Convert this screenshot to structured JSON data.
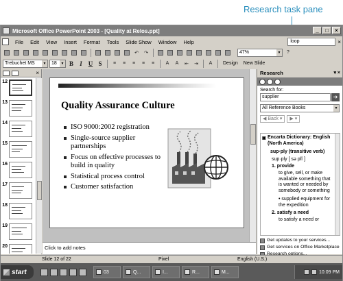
{
  "callout": {
    "text": "Research task pane"
  },
  "window": {
    "title": "Microsoft Office PowerPoint 2003 - [Quality at Relos.ppt]"
  },
  "menu": {
    "items": [
      "File",
      "Edit",
      "View",
      "Insert",
      "Format",
      "Tools",
      "Slide Show",
      "Window",
      "Help"
    ],
    "ask_value": "loop"
  },
  "toolbar": {
    "zoom": "47%",
    "font": "Trebuchet MS",
    "size": "18",
    "bold": "B",
    "italic": "I",
    "underline": "U",
    "shadow": "S",
    "design_label": "Design",
    "new_slide_label": "New Slide"
  },
  "thumbnails": [
    "12",
    "13",
    "14",
    "15",
    "16",
    "17",
    "18",
    "19",
    "20"
  ],
  "slide": {
    "title": "Quality Assurance Culture",
    "bullets": [
      "ISO 9000:2002 registration",
      "Single-source supplier partnerships",
      "Focus on effective processes to build in quality",
      "Statistical process control",
      "Customer satisfaction"
    ]
  },
  "notes": {
    "placeholder": "Click to add notes"
  },
  "research": {
    "title": "Research",
    "search_label": "Search for:",
    "search_value": "supplier",
    "source": "All Reference Books",
    "back": "Back",
    "entry_title": "Encarta Dictionary: English (North America)",
    "word": "sup·ply (transitive verb)",
    "pron": "sup·ply [ sə plî ]",
    "def1": "1. provide",
    "sense1": "to give, sell, or make available something that is wanted or needed by somebody or something",
    "example1": "• supplied equipment for the expedition",
    "def2": "2. satisfy a need",
    "sense2": "to satisfy a need or",
    "links": [
      "Get updates to your services...",
      "Get services on Office Marketplace",
      "Research options..."
    ]
  },
  "status": {
    "slide": "Slide 12 of 22",
    "design": "Pixel",
    "language": "English (U.S.)"
  },
  "taskbar": {
    "start": "start",
    "tasks": [
      "03",
      "Q...",
      "I...",
      "R...",
      "M..."
    ],
    "clock": "10:09 PM"
  }
}
